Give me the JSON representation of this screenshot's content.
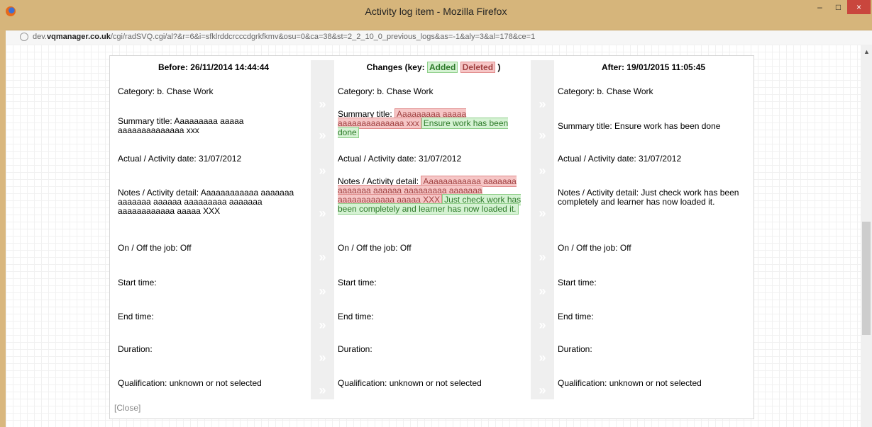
{
  "window": {
    "title": "Activity log item - Mozilla Firefox",
    "minimize": "–",
    "maximize": "□",
    "close": "×"
  },
  "urlbar": {
    "host_prefix": "dev.",
    "host_domain": "vqmanager.co.uk",
    "path": "/cgi/radSVQ.cgi/al?&r=6&i=sfklrddcrcccdgrkfkmv&osu=0&ca=38&st=2_2_10_0_previous_logs&as=-1&aly=3&al=178&ce=1"
  },
  "headers": {
    "before": "Before: 26/11/2014 14:44:44",
    "changes_prefix": "Changes (key: ",
    "key_added": "Added",
    "key_deleted": "Deleted",
    "changes_suffix": ")",
    "after": "After: 19/01/2015 11:05:45"
  },
  "before": {
    "category": "Category: b. Chase Work",
    "summary": "Summary title: Aaaaaaaaa aaaaa aaaaaaaaaaaaaa xxx",
    "actual_date": "Actual / Activity date: 31/07/2012",
    "notes": "Notes / Activity detail: Aaaaaaaaaaaa aaaaaaa aaaaaaa aaaaaa aaaaaaaaa aaaaaaa aaaaaaaaaaaa aaaaa XXX",
    "onoff": "On / Off the job: Off",
    "start": "Start time:",
    "end": "End time:",
    "duration": "Duration:",
    "qualification": "Qualification: unknown or not selected"
  },
  "changes": {
    "category": "Category: b. Chase Work",
    "summary_label": "Summary title:",
    "summary_deleted": "Aaaaaaaaa aaaaa aaaaaaaaaaaaaa xxx",
    "summary_added": "Ensure work has been done",
    "actual_date": "Actual / Activity date: 31/07/2012",
    "notes_label": "Notes / Activity detail:",
    "notes_deleted": "Aaaaaaaaaaaa aaaaaaa aaaaaaa aaaaaa aaaaaaaaa aaaaaaa aaaaaaaaaaaa aaaaa XXX",
    "notes_added": "Just check work has been completely and learner has now loaded it.",
    "onoff": "On / Off the job: Off",
    "start": "Start time:",
    "end": "End time:",
    "duration": "Duration:",
    "qualification": "Qualification: unknown or not selected"
  },
  "after": {
    "category": "Category: b. Chase Work",
    "summary": "Summary title: Ensure work has been done",
    "actual_date": "Actual / Activity date: 31/07/2012",
    "notes": "Notes / Activity detail: Just check work has been completely and learner has now loaded it.",
    "onoff": "On / Off the job: Off",
    "start": "Start time:",
    "end": "End time:",
    "duration": "Duration:",
    "qualification": "Qualification: unknown or not selected"
  },
  "separator_glyph": "»",
  "close_label": "[Close]",
  "colors": {
    "added_bg": "#d5f2d3",
    "deleted_bg": "#f6c6c6",
    "titlebar": "#d6b57b"
  }
}
